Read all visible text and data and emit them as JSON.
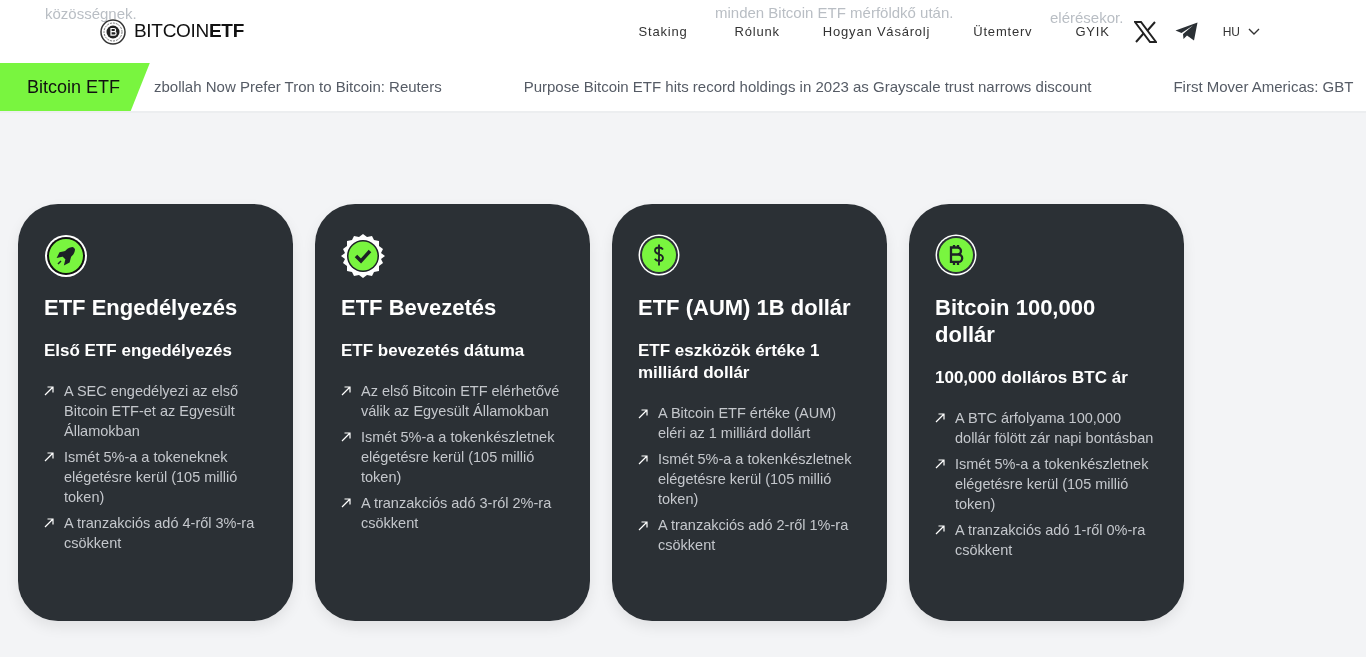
{
  "faded_texts": [
    "közösségnek.",
    "minden Bitcoin ETF mérföldkő után.",
    "elérésekor."
  ],
  "header": {
    "logo": {
      "light": "BITCOIN",
      "bold": "ETF"
    },
    "nav": [
      "Staking",
      "Rólunk",
      "Hogyan Vásárolj",
      "Ütemterv",
      "GYIK"
    ],
    "social": [
      {
        "kind": "x"
      },
      {
        "kind": "telegram"
      }
    ],
    "language": "HU"
  },
  "ticker": {
    "label": "Bitcoin ETF",
    "items": [
      "zbollah Now Prefer Tron to Bitcoin: Reuters",
      "Purpose Bitcoin ETF hits record holdings in 2023 as Grayscale trust narrows discount",
      "First Mover Americas: GBT"
    ]
  },
  "milestones": [
    {
      "kind": "rocket",
      "title": "ETF Engedélyezés",
      "subtitle": "Első ETF engedélyezés",
      "points": [
        "A SEC engedélyezi az első Bitcoin ETF-et az Egyesült Államokban",
        "Ismét 5%-a a tokeneknek elégetésre kerül (105 millió token)",
        "A tranzakciós adó 4-ről 3%-ra csökkent"
      ]
    },
    {
      "kind": "check",
      "title": "ETF Bevezetés",
      "subtitle": "ETF bevezetés dátuma",
      "points": [
        "Az első Bitcoin ETF elérhetővé válik az Egyesült Államokban",
        "Ismét 5%-a a tokenkészletnek elégetésre kerül (105 millió token)",
        "A tranzakciós adó 3-ról 2%-ra csökkent"
      ]
    },
    {
      "kind": "dollar",
      "title": "ETF (AUM) 1B dollár",
      "subtitle": "ETF eszközök értéke 1 milliárd dollár",
      "points": [
        "A Bitcoin ETF értéke (AUM) eléri az 1 milliárd dollárt",
        "Ismét 5%-a a tokenkészletnek elégetésre kerül (105 millió token)",
        "A tranzakciós adó 2-ről 1%-ra csökkent"
      ]
    },
    {
      "kind": "bitcoin",
      "title": "Bitcoin 100,000 dollár",
      "subtitle": "100,000 dolláros BTC ár",
      "points": [
        "A BTC árfolyama 100,000 dollár fölött zár napi bontásban",
        "Ismét 5%-a a tokenkészletnek elégetésre kerül (105 millió token)",
        "A tranzakciós adó 1-ről 0%-ra csökkent"
      ]
    }
  ]
}
